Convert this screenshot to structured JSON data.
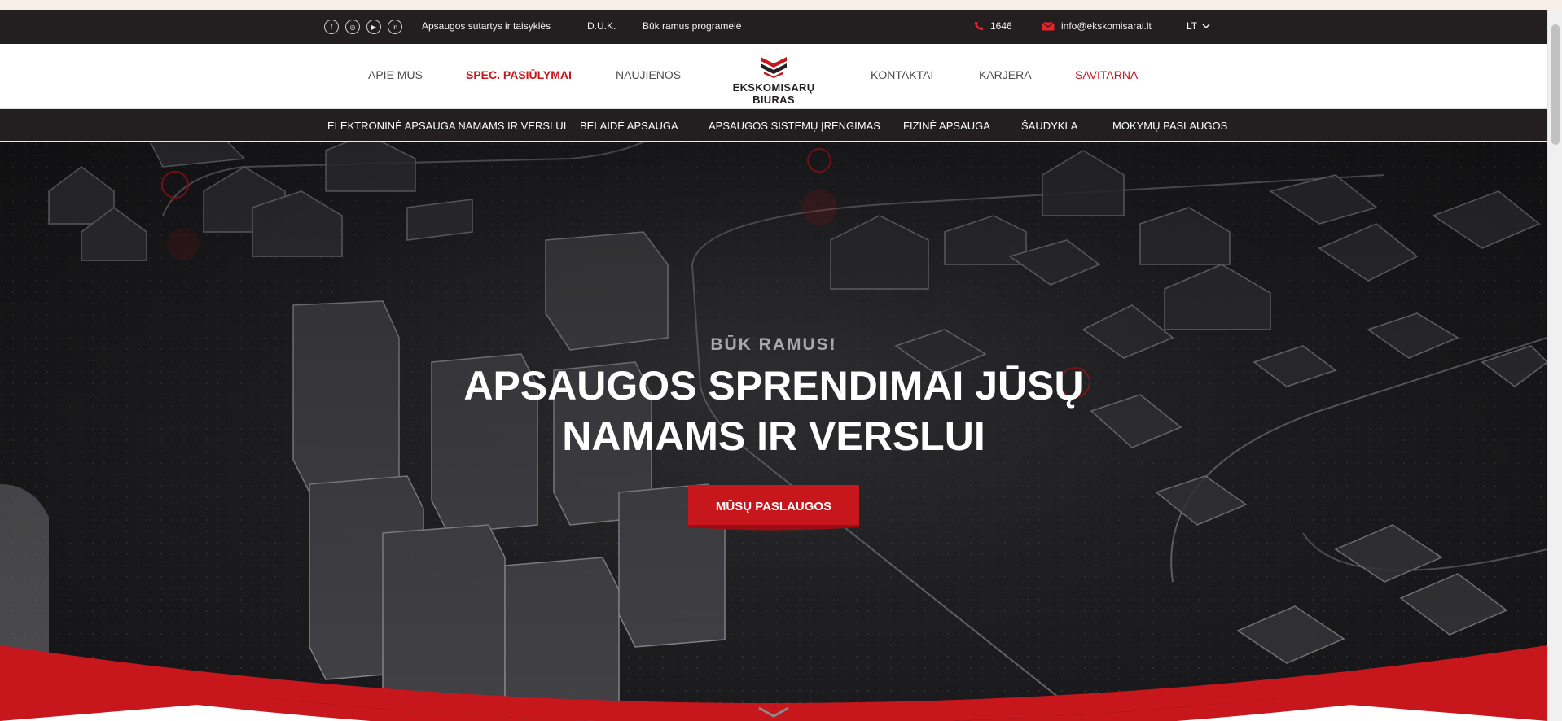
{
  "topbar": {
    "social_icons": [
      "facebook-icon",
      "instagram-icon",
      "youtube-icon",
      "linkedin-icon"
    ],
    "social_glyphs": [
      "f",
      "◎",
      "▶",
      "in"
    ],
    "links": [
      "Apsaugos sutartys ir taisyklės",
      "D.U.K.",
      "Būk ramus programėlė"
    ],
    "phone": "1646",
    "email": "info@ekskomisarai.lt",
    "language": "LT"
  },
  "mainnav": {
    "left_items": [
      "APIE MUS",
      "SPEC. PASIŪLYMAI",
      "NAUJIENOS"
    ],
    "right_items": [
      "KONTAKTAI",
      "KARJERA",
      "SAVITARNA"
    ],
    "logo_text": "EKSKOMISARŲ BIURAS"
  },
  "subnav": {
    "items": [
      "ELEKTRONINĖ APSAUGA NAMAMS IR VERSLUI",
      "BELAIDĖ APSAUGA",
      "APSAUGOS SISTEMŲ ĮRENGIMAS",
      "FIZINĖ APSAUGA",
      "ŠAUDYKLA",
      "MOKYMŲ PASLAUGOS"
    ]
  },
  "hero": {
    "kicker": "BŪK RAMUS!",
    "headline_line1": "APSAUGOS SPRENDIMAI JŪSŲ",
    "headline_line2": "NAMAMS IR VERSLUI",
    "cta_label": "MŪSŲ PASLAUGOS"
  },
  "colors": {
    "brand_red": "#c8161d",
    "topbar_bg": "#231f20",
    "hero_bg": "#1c1c1e"
  }
}
